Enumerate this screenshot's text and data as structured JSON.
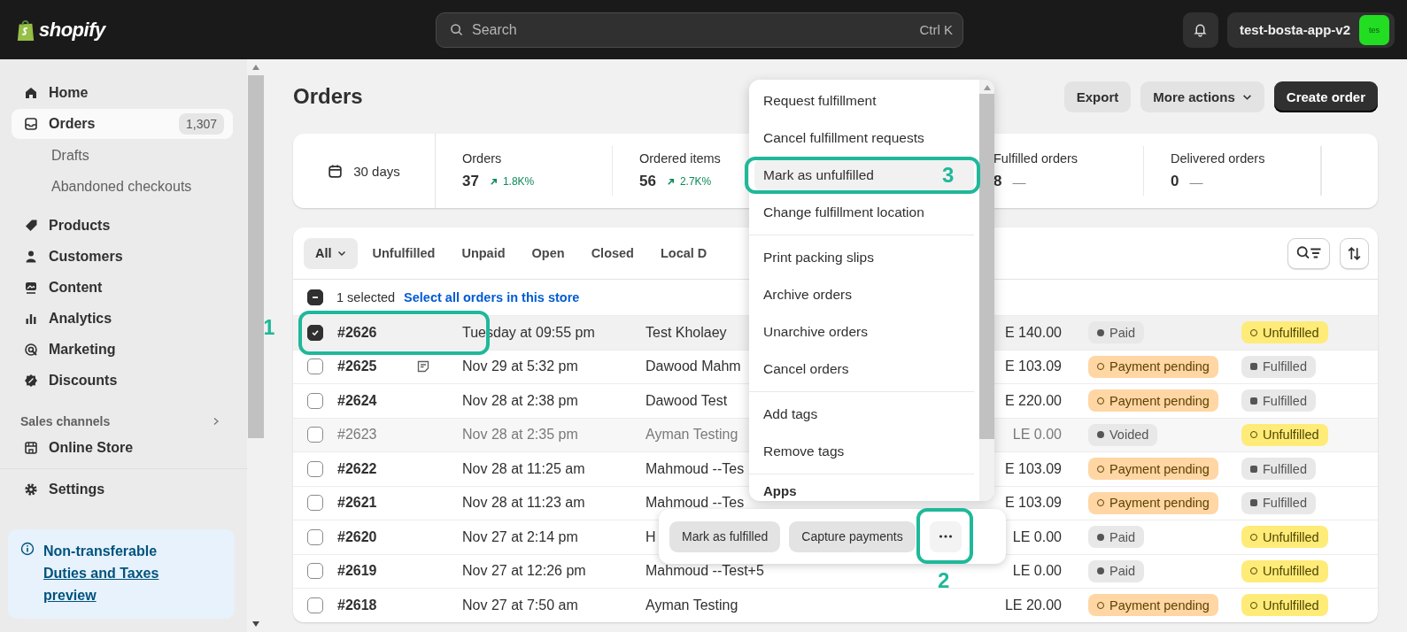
{
  "topbar": {
    "brand": "shopify",
    "search": {
      "placeholder": "Search",
      "shortcut": "Ctrl K"
    },
    "store": {
      "name": "test-bosta-app-v2",
      "avatar": "tes"
    }
  },
  "sidebar": {
    "items": [
      {
        "label": "Home",
        "selected": false
      },
      {
        "label": "Orders",
        "selected": true,
        "count": "1,307",
        "children": [
          {
            "label": "Drafts",
            "selected": false
          },
          {
            "label": "Abandoned checkouts",
            "selected": false
          }
        ]
      },
      {
        "label": "Products",
        "selected": false
      },
      {
        "label": "Customers",
        "selected": false
      },
      {
        "label": "Content",
        "selected": false
      },
      {
        "label": "Analytics",
        "selected": false
      },
      {
        "label": "Marketing",
        "selected": false
      },
      {
        "label": "Discounts",
        "selected": false
      }
    ],
    "sales_channels": {
      "heading": "Sales channels",
      "items": [
        {
          "label": "Online Store",
          "selected": false
        }
      ]
    },
    "settings": {
      "label": "Settings",
      "selected": false
    },
    "banner": {
      "text": "Non-transferable",
      "link": "Duties and Taxes preview"
    }
  },
  "page": {
    "title": "Orders",
    "actions": [
      "Export",
      "More actions",
      "Create order"
    ]
  },
  "stats": {
    "period": "30 days",
    "items": [
      {
        "label": "Orders",
        "value": "37",
        "trend": "1.8K%",
        "kind": "up"
      },
      {
        "label": "Ordered items",
        "value": "56",
        "trend": "2.7K%",
        "kind": "up"
      },
      {
        "label": "Fulfilled orders",
        "value": "8",
        "trend": "—",
        "kind": "flat"
      },
      {
        "label": "Delivered orders",
        "value": "0",
        "trend": "—",
        "kind": "flat"
      }
    ]
  },
  "filters": [
    {
      "label": "All",
      "selected": true
    },
    {
      "label": "Unfulfilled",
      "selected": false
    },
    {
      "label": "Unpaid",
      "selected": false
    },
    {
      "label": "Open",
      "selected": false
    },
    {
      "label": "Closed",
      "selected": false
    },
    {
      "label": "Local D",
      "selected": false
    }
  ],
  "bulk": {
    "indeterminate": true,
    "count": "1 selected",
    "link": "Select all orders in this store"
  },
  "rows": [
    {
      "checked": true,
      "muted": false,
      "order": "#2626",
      "note": false,
      "date": "Tuesday at 09:55 pm",
      "customer": "Test Kholaey",
      "total": "E 140.00",
      "payment": {
        "label": "Paid",
        "kind": "paid"
      },
      "fulfillment": {
        "label": "Unfulfilled",
        "kind": "unfulfilled"
      }
    },
    {
      "checked": false,
      "muted": false,
      "order": "#2625",
      "note": true,
      "date": "Nov 29 at 5:32 pm",
      "customer": "Dawood Mahm",
      "total": "E 103.09",
      "payment": {
        "label": "Payment pending",
        "kind": "pending"
      },
      "fulfillment": {
        "label": "Fulfilled",
        "kind": "fulfilled"
      }
    },
    {
      "checked": false,
      "muted": false,
      "order": "#2624",
      "note": false,
      "date": "Nov 28 at 2:38 pm",
      "customer": "Dawood Test",
      "total": "E 220.00",
      "payment": {
        "label": "Payment pending",
        "kind": "pending"
      },
      "fulfillment": {
        "label": "Fulfilled",
        "kind": "fulfilled"
      }
    },
    {
      "checked": false,
      "muted": true,
      "order": "#2623",
      "note": false,
      "date": "Nov 28 at 2:35 pm",
      "customer": "Ayman Testing",
      "total": "LE 0.00",
      "payment": {
        "label": "Voided",
        "kind": "voided"
      },
      "fulfillment": {
        "label": "Unfulfilled",
        "kind": "unfulfilled"
      }
    },
    {
      "checked": false,
      "muted": false,
      "order": "#2622",
      "note": false,
      "date": "Nov 28 at 11:25 am",
      "customer": "Mahmoud --Tes",
      "total": "E 103.09",
      "payment": {
        "label": "Payment pending",
        "kind": "pending"
      },
      "fulfillment": {
        "label": "Fulfilled",
        "kind": "fulfilled"
      }
    },
    {
      "checked": false,
      "muted": false,
      "order": "#2621",
      "note": false,
      "date": "Nov 28 at 11:23 am",
      "customer": "Mahmoud --Tes",
      "total": "E 103.09",
      "payment": {
        "label": "Payment pending",
        "kind": "pending"
      },
      "fulfillment": {
        "label": "Fulfilled",
        "kind": "fulfilled"
      }
    },
    {
      "checked": false,
      "muted": false,
      "order": "#2620",
      "note": false,
      "date": "Nov 27 at 2:14 pm",
      "customer": "H",
      "total": "LE 0.00",
      "payment": {
        "label": "Paid",
        "kind": "paid"
      },
      "fulfillment": {
        "label": "Unfulfilled",
        "kind": "unfulfilled"
      }
    },
    {
      "checked": false,
      "muted": false,
      "order": "#2619",
      "note": false,
      "date": "Nov 27 at 12:26 pm",
      "customer": "Mahmoud --Test+5",
      "total": "LE 0.00",
      "payment": {
        "label": "Paid",
        "kind": "paid"
      },
      "fulfillment": {
        "label": "Unfulfilled",
        "kind": "unfulfilled"
      }
    },
    {
      "checked": false,
      "muted": false,
      "order": "#2618",
      "note": false,
      "date": "Nov 27 at 7:50 am",
      "customer": "Ayman Testing",
      "total": "LE 20.00",
      "payment": {
        "label": "Payment pending",
        "kind": "pending"
      },
      "fulfillment": {
        "label": "Unfulfilled",
        "kind": "unfulfilled"
      }
    }
  ],
  "menu": {
    "groups": [
      {
        "items": [
          {
            "label": "Request fulfillment",
            "selected": false
          },
          {
            "label": "Cancel fulfillment requests",
            "selected": false
          },
          {
            "label": "Mark as unfulfilled",
            "selected": true
          },
          {
            "label": "Change fulfillment location",
            "selected": false
          }
        ]
      },
      {
        "items": [
          {
            "label": "Print packing slips",
            "selected": false
          },
          {
            "label": "Archive orders",
            "selected": false
          },
          {
            "label": "Unarchive orders",
            "selected": false
          },
          {
            "label": "Cancel orders",
            "selected": false
          }
        ]
      },
      {
        "items": [
          {
            "label": "Add tags",
            "selected": false
          },
          {
            "label": "Remove tags",
            "selected": false
          }
        ]
      },
      {
        "heading": "Apps"
      }
    ]
  },
  "bulk_bar": {
    "buttons": [
      "Mark as fulfilled",
      "Capture payments"
    ]
  },
  "annotations": [
    {
      "label": "1",
      "kind": "row"
    },
    {
      "label": "2",
      "kind": "more"
    },
    {
      "label": "3",
      "kind": "menu"
    }
  ]
}
